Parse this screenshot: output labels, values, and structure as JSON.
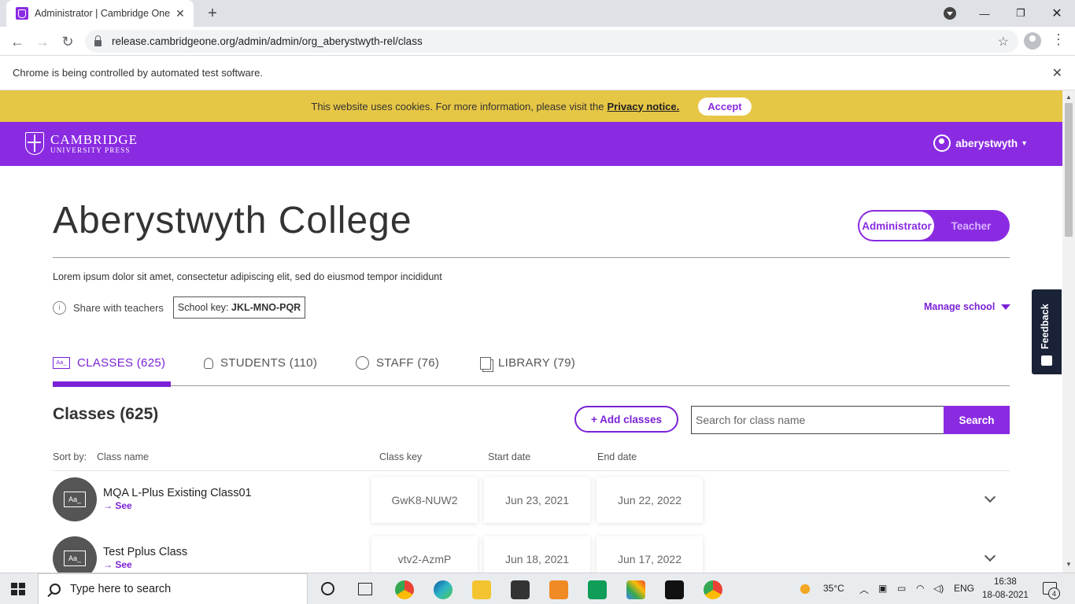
{
  "browser": {
    "tab_title": "Administrator | Cambridge One",
    "url": "release.cambridgeone.org/admin/admin/org_aberystwyth-rel/class",
    "infobar_text": "Chrome is being controlled by automated test software."
  },
  "cookie_banner": {
    "text": "This website uses cookies. For more information, please visit the",
    "link": "Privacy notice.",
    "accept_label": "Accept"
  },
  "header": {
    "logo_line1": "CAMBRIDGE",
    "logo_line2": "UNIVERSITY PRESS",
    "username": "aberystwyth"
  },
  "org": {
    "title": "Aberystwyth College",
    "description": "Lorem ipsum dolor sit amet, consectetur adipiscing elit, sed do eiusmod tempor incididunt",
    "share_label": "Share with teachers",
    "school_key_label": "School key:",
    "school_key": "JKL-MNO-PQR",
    "manage_label": "Manage school",
    "roles": {
      "admin": "Administrator",
      "teacher": "Teacher"
    }
  },
  "feedback_label": "Feedback",
  "tabs": [
    {
      "label": "CLASSES (625)",
      "active": true
    },
    {
      "label": "STUDENTS (110)",
      "active": false
    },
    {
      "label": "STAFF (76)",
      "active": false
    },
    {
      "label": "LIBRARY (79)",
      "active": false
    }
  ],
  "classes": {
    "heading": "Classes (625)",
    "add_label": "+ Add classes",
    "search_placeholder": "Search for class name",
    "search_button": "Search",
    "sort_label": "Sort by:",
    "columns": {
      "name": "Class name",
      "key": "Class key",
      "start": "Start date",
      "end": "End date"
    },
    "see_label": "→ See",
    "avatar_text": "Aa_",
    "rows": [
      {
        "name": "MQA L-Plus Existing Class01",
        "key": "GwK8-NUW2",
        "start": "Jun 23, 2021",
        "end": "Jun 22, 2022"
      },
      {
        "name": "Test Pplus Class",
        "key": "vtv2-AzmP",
        "start": "Jun 18, 2021",
        "end": "Jun 17, 2022"
      }
    ]
  },
  "taskbar": {
    "search_placeholder": "Type here to search",
    "temperature": "35°C",
    "language": "ENG",
    "time": "16:38",
    "date": "18-08-2021",
    "notification_count": "4"
  },
  "colors": {
    "brand": "#8a2be2",
    "cookie": "#e6c645",
    "accent_text": "#7b22d6"
  }
}
